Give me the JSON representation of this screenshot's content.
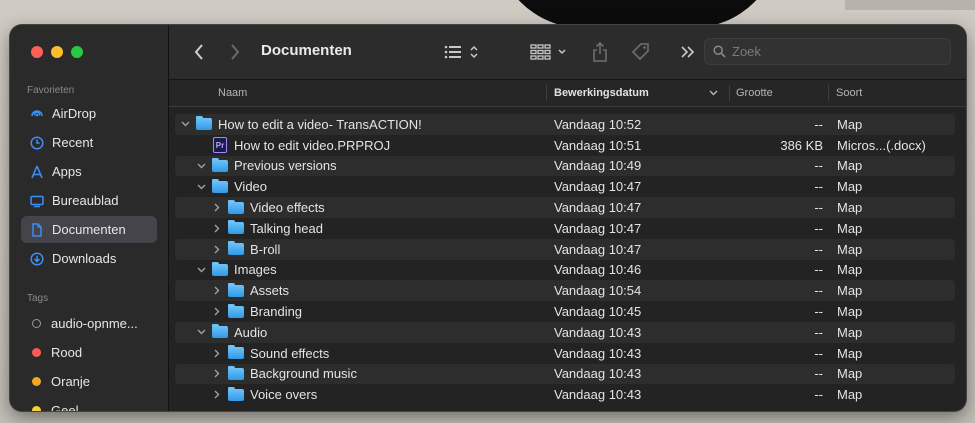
{
  "window": {
    "title": "Documenten",
    "search_placeholder": "Zoek"
  },
  "sidebar": {
    "favorites_header": "Favorieten",
    "favorites": [
      {
        "label": "AirDrop",
        "icon": "airdrop-icon"
      },
      {
        "label": "Recent",
        "icon": "clock-icon"
      },
      {
        "label": "Apps",
        "icon": "apps-icon"
      },
      {
        "label": "Bureaublad",
        "icon": "desktop-icon"
      },
      {
        "label": "Documenten",
        "icon": "document-icon",
        "active": true
      },
      {
        "label": "Downloads",
        "icon": "download-icon"
      }
    ],
    "tags_header": "Tags",
    "tags": [
      {
        "label": "audio-opnme...",
        "color": "#9a9a9a"
      },
      {
        "label": "Rood",
        "color": "#ff5a52"
      },
      {
        "label": "Oranje",
        "color": "#f5a623"
      },
      {
        "label": "Geel",
        "color": "#f7d13b"
      }
    ]
  },
  "columns": {
    "name": "Naam",
    "date": "Bewerkingsdatum",
    "size": "Grootte",
    "kind": "Soort"
  },
  "files": [
    {
      "name": "How to edit a video- TransACTION!",
      "date": "Vandaag 10:52",
      "size": "--",
      "kind": "Map",
      "level": 0,
      "type": "folder",
      "expanded": true
    },
    {
      "name": "How to edit video.PRPROJ",
      "date": "Vandaag 10:51",
      "size": "386 KB",
      "kind": "Micros...(.docx)",
      "level": 1,
      "type": "file"
    },
    {
      "name": "Previous versions",
      "date": "Vandaag 10:49",
      "size": "--",
      "kind": "Map",
      "level": 1,
      "type": "folder",
      "expanded": true
    },
    {
      "name": "Video",
      "date": "Vandaag 10:47",
      "size": "--",
      "kind": "Map",
      "level": 1,
      "type": "folder",
      "expanded": true
    },
    {
      "name": "Video effects",
      "date": "Vandaag 10:47",
      "size": "--",
      "kind": "Map",
      "level": 2,
      "type": "folder",
      "expanded": false
    },
    {
      "name": "Talking head",
      "date": "Vandaag 10:47",
      "size": "--",
      "kind": "Map",
      "level": 2,
      "type": "folder",
      "expanded": false
    },
    {
      "name": "B-roll",
      "date": "Vandaag 10:47",
      "size": "--",
      "kind": "Map",
      "level": 2,
      "type": "folder",
      "expanded": false
    },
    {
      "name": "Images",
      "date": "Vandaag 10:46",
      "size": "--",
      "kind": "Map",
      "level": 1,
      "type": "folder",
      "expanded": true
    },
    {
      "name": "Assets",
      "date": "Vandaag 10:54",
      "size": "--",
      "kind": "Map",
      "level": 2,
      "type": "folder",
      "expanded": false
    },
    {
      "name": "Branding",
      "date": "Vandaag 10:45",
      "size": "--",
      "kind": "Map",
      "level": 2,
      "type": "folder",
      "expanded": false
    },
    {
      "name": "Audio",
      "date": "Vandaag 10:43",
      "size": "--",
      "kind": "Map",
      "level": 1,
      "type": "folder",
      "expanded": true
    },
    {
      "name": "Sound effects",
      "date": "Vandaag 10:43",
      "size": "--",
      "kind": "Map",
      "level": 2,
      "type": "folder",
      "expanded": false
    },
    {
      "name": "Background music",
      "date": "Vandaag 10:43",
      "size": "--",
      "kind": "Map",
      "level": 2,
      "type": "folder",
      "expanded": false
    },
    {
      "name": "Voice overs",
      "date": "Vandaag 10:43",
      "size": "--",
      "kind": "Map",
      "level": 2,
      "type": "folder",
      "expanded": false
    }
  ]
}
